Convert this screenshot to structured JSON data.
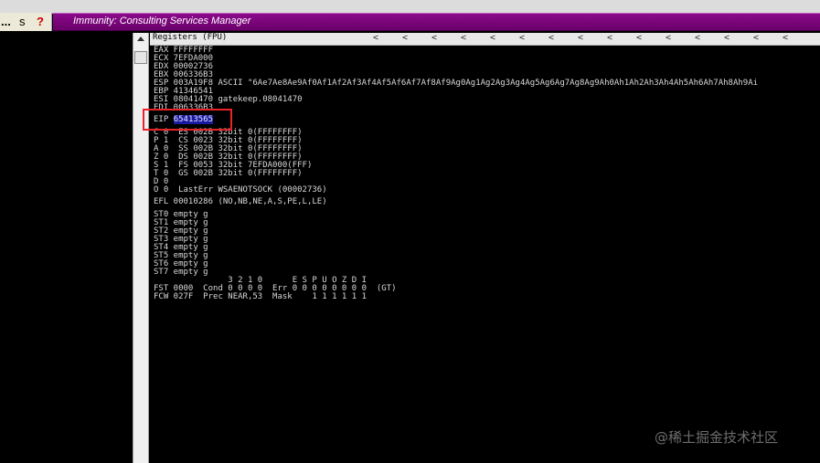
{
  "toolbar": {
    "dots": "...",
    "s": "s",
    "help": "?"
  },
  "window": {
    "title": "Immunity: Consulting Services Manager"
  },
  "registers": {
    "header": "Registers (FPU)",
    "lines": [
      "EAX FFFFFFFF",
      "ECX 7EFDA000",
      "EDX 00002736",
      "EBX 006336B3",
      "ESP 003A19F8 ASCII \"6Ae7Ae8Ae9Af0Af1Af2Af3Af4Af5Af6Af7Af8Af9Ag0Ag1Ag2Ag3Ag4Ag5Ag6Ag7Ag8Ag9Ah0Ah1Ah2Ah3Ah4Ah5Ah6Ah7Ah8Ah9Ai",
      "EBP 41346541",
      "ESI 08041470 gatekeep.08041470",
      "EDI 006336B3"
    ],
    "eip_label": "EIP",
    "eip_value": "65413565",
    "flags": [
      "C 0  ES 002B 32bit 0(FFFFFFFF)",
      "P 1  CS 0023 32bit 0(FFFFFFFF)",
      "A 0  SS 002B 32bit 0(FFFFFFFF)",
      "Z 0  DS 002B 32bit 0(FFFFFFFF)",
      "S 1  FS 0053 32bit 7EFDA000(FFF)",
      "T 0  GS 002B 32bit 0(FFFFFFFF)",
      "D 0",
      "O 0  LastErr WSAENOTSOCK (00002736)"
    ],
    "efl": "EFL 00010286 (NO,NB,NE,A,S,PE,L,LE)",
    "st": [
      "ST0 empty g",
      "ST1 empty g",
      "ST2 empty g",
      "ST3 empty g",
      "ST4 empty g",
      "ST5 empty g",
      "ST6 empty g",
      "ST7 empty g"
    ],
    "fpu": [
      "               3 2 1 0      E S P U O Z D I",
      "FST 0000  Cond 0 0 0 0  Err 0 0 0 0 0 0 0 0  (GT)",
      "FCW 027F  Prec NEAR,53  Mask    1 1 1 1 1 1"
    ]
  },
  "watermark": "@稀土掘金技术社区"
}
